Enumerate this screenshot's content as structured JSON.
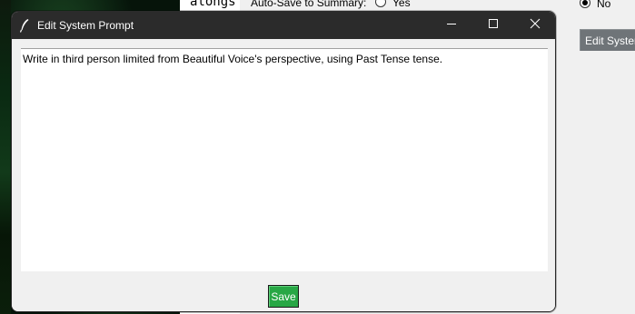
{
  "background": {
    "code_snippet": "alongs",
    "autosave_label": "Auto-Save to Summary:",
    "radio_yes_label": "Yes",
    "radio_no_label": "No",
    "edit_button_label": "Edit System Prompt"
  },
  "dialog": {
    "title": "Edit System Prompt",
    "icon": "feather-icon",
    "controls": {
      "minimize": "minimize-icon",
      "maximize": "maximize-icon",
      "close": "close-icon"
    },
    "prompt_text": "Write in third person limited from Beautiful Voice's perspective, using Past Tense tense.",
    "save_label": "Save"
  },
  "colors": {
    "titlebar": "#2b2b2b",
    "save_button": "#28a745",
    "window_bg": "#f0f0f0",
    "edit_button": "#6f7478"
  }
}
